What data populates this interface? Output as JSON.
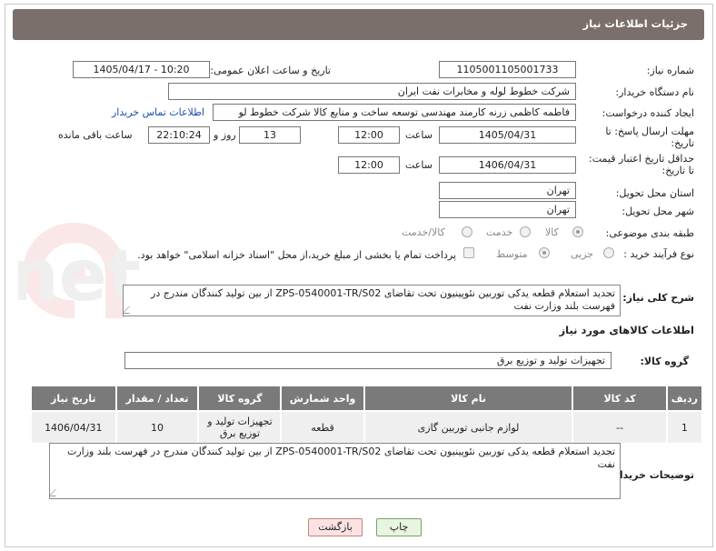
{
  "header": {
    "title": "جزئیات اطلاعات نیاز"
  },
  "fields": {
    "need_number": {
      "label": "شماره نیاز:",
      "value": "1105001105001733"
    },
    "announce": {
      "label": "تاریخ و ساعت اعلان عمومی:",
      "value": "1405/04/17 - 10:20"
    },
    "buyer": {
      "label": "نام دستگاه خریدار:",
      "value": "شرکت خطوط لوله و مخابرات نفت ایران"
    },
    "creator": {
      "label": "ایجاد کننده درخواست:",
      "value": "فاطمه کاظمی زرنه کارمند مهندسی توسعه ساخت و منابع کالا شرکت خطوط لو",
      "contact_link": "اطلاعات تماس خریدار"
    },
    "deadline": {
      "label_line1": "مهلت ارسال پاسخ: تا",
      "label_line2": "تاریخ:",
      "date": "1405/04/31",
      "time_label": "ساعت",
      "time": "12:00",
      "days": "13",
      "days_label": "روز و",
      "remaining": "22:10:24",
      "remaining_label": "ساعت باقی مانده"
    },
    "price_validity": {
      "label_line1": "حداقل تاریخ اعتبار قیمت:",
      "label_line2": "تا تاریخ:",
      "date": "1406/04/31",
      "time_label": "ساعت",
      "time": "12:00"
    },
    "province": {
      "label": "استان محل تحویل:",
      "value": "تهران"
    },
    "city": {
      "label": "شهر محل تحویل:",
      "value": "تهران"
    },
    "category": {
      "label": "طبقه بندی موضوعی:",
      "options": [
        "کالا",
        "خدمت",
        "کالا/خدمت"
      ],
      "selected": "کالا"
    },
    "process": {
      "label": "نوع فرآیند خرید :",
      "options": [
        "جزیی",
        "متوسط"
      ],
      "selected": "متوسط",
      "payment_note": "پرداخت تمام یا بخشی از مبلغ خرید،از محل \"اسناد خزانه اسلامی\" خواهد بود."
    }
  },
  "description": {
    "label": "شرح کلی نیاز:",
    "text": "تجدید استعلام قطعه یدکی توربین نئوپینیون تحت تقاضای ZPS-0540001-TR/S02 از بین تولید کنندگان مندرج در فهرست بلند وزارت نفت"
  },
  "goods_section": {
    "title": "اطلاعات کالاهای مورد نیاز",
    "group_label": "گروه کالا:",
    "group_value": "تجهیزات تولید و توزیع برق"
  },
  "table": {
    "headers": [
      "ردیف",
      "کد کالا",
      "نام کالا",
      "واحد شمارش",
      "گروه کالا",
      "تعداد / مقدار",
      "تاریخ نیاز"
    ],
    "rows": [
      [
        "1",
        "--",
        "لوازم جانبی توربین گازی",
        "قطعه",
        "تجهیزات تولید و توزیع برق",
        "10",
        "1406/04/31"
      ]
    ]
  },
  "buyer_notes": {
    "label": "توضیحات خریدار:",
    "text": "تجدید استعلام قطعه یدکی توربین نئوپینیون تحت تقاضای ZPS-0540001-TR/S02 از بین تولید کنندگان مندرج در فهرست بلند وزارت نفت"
  },
  "buttons": {
    "print": "چاپ",
    "back": "بازگشت"
  },
  "watermark": {
    "text": "AriaTender.net"
  }
}
